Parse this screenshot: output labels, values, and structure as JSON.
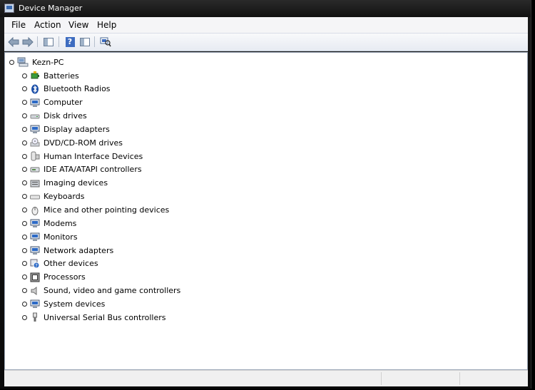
{
  "window": {
    "title": "Device Manager"
  },
  "menu": [
    "File",
    "Action",
    "View",
    "Help"
  ],
  "tree": {
    "root": "Kezn-PC",
    "categories": [
      {
        "label": "Batteries",
        "icon": "battery-icon",
        "color": "#3b9b3b"
      },
      {
        "label": "Bluetooth Radios",
        "icon": "bluetooth-icon",
        "color": "#1b4fa8"
      },
      {
        "label": "Computer",
        "icon": "computer-icon",
        "color": "#2d6ac6"
      },
      {
        "label": "Disk drives",
        "icon": "disk-drive-icon",
        "color": "#8a8a8a"
      },
      {
        "label": "Display adapters",
        "icon": "display-adapter-icon",
        "color": "#2d6ac6"
      },
      {
        "label": "DVD/CD-ROM drives",
        "icon": "dvd-drive-icon",
        "color": "#8a8a8a"
      },
      {
        "label": "Human Interface Devices",
        "icon": "hid-icon",
        "color": "#7a7a7a"
      },
      {
        "label": "IDE ATA/ATAPI controllers",
        "icon": "ide-controller-icon",
        "color": "#5e8c52"
      },
      {
        "label": "Imaging devices",
        "icon": "imaging-device-icon",
        "color": "#6b6b6b"
      },
      {
        "label": "Keyboards",
        "icon": "keyboard-icon",
        "color": "#8a8a8a"
      },
      {
        "label": "Mice and other pointing devices",
        "icon": "mouse-icon",
        "color": "#6b6b6b"
      },
      {
        "label": "Modems",
        "icon": "modem-icon",
        "color": "#2d6ac6"
      },
      {
        "label": "Monitors",
        "icon": "monitor-icon",
        "color": "#2d6ac6"
      },
      {
        "label": "Network adapters",
        "icon": "network-adapter-icon",
        "color": "#2d6ac6"
      },
      {
        "label": "Other devices",
        "icon": "other-devices-icon",
        "color": "#2d6ac6"
      },
      {
        "label": "Processors",
        "icon": "processor-icon",
        "color": "#333333"
      },
      {
        "label": "Sound, video and game controllers",
        "icon": "sound-icon",
        "color": "#6b6b6b"
      },
      {
        "label": "System devices",
        "icon": "system-devices-icon",
        "color": "#2d6ac6"
      },
      {
        "label": "Universal Serial Bus controllers",
        "icon": "usb-icon",
        "color": "#6b6b6b"
      }
    ]
  },
  "toolbar": {
    "buttons": [
      "back-arrow-icon",
      "forward-arrow-icon",
      "show-hide-console-tree-icon",
      "help-icon",
      "properties-pane-icon",
      "scan-hardware-icon"
    ]
  }
}
